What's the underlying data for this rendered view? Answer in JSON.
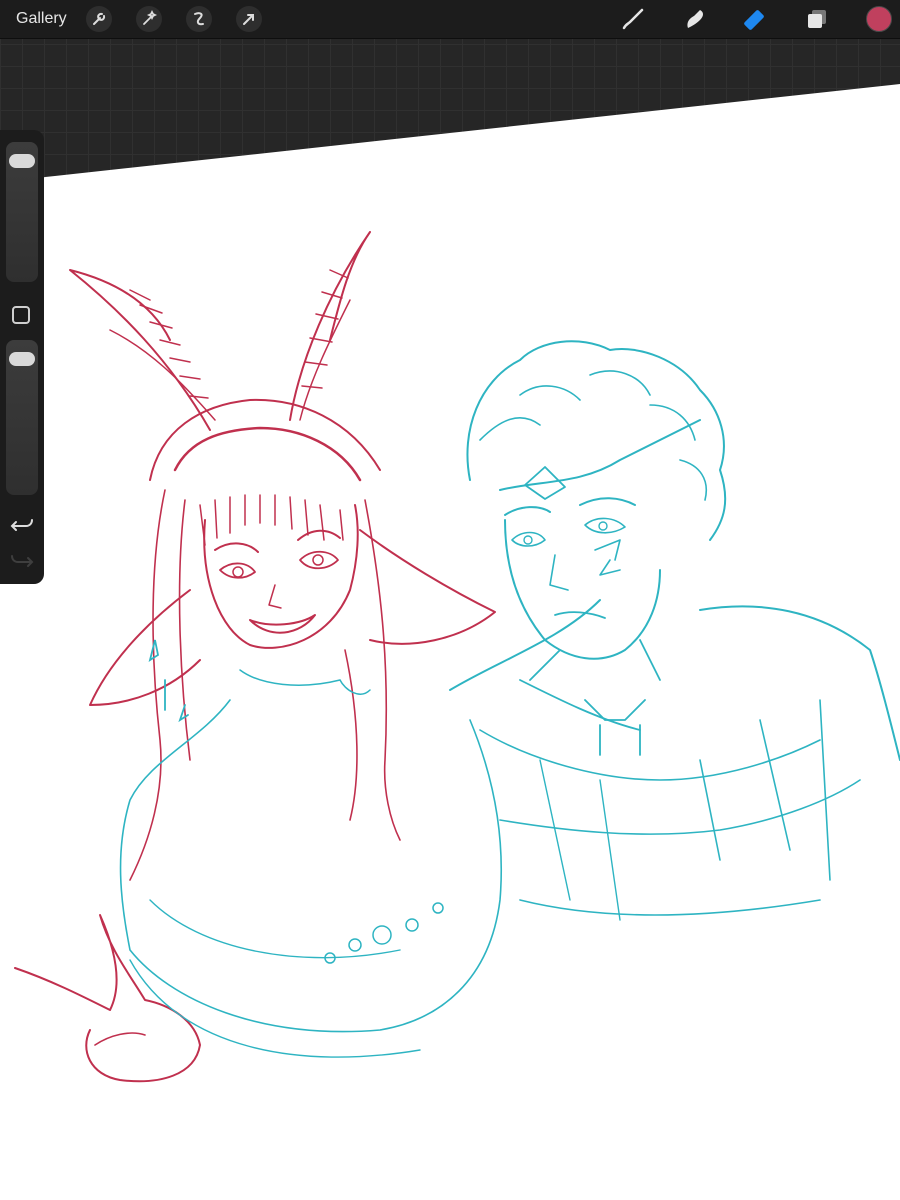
{
  "toolbar": {
    "gallery_label": "Gallery",
    "left_tools": [
      "wrench-icon",
      "magic-wand-icon",
      "selection-icon",
      "transform-arrow-icon"
    ],
    "right_tools": [
      "brush-icon",
      "smudge-icon",
      "eraser-icon",
      "layers-icon"
    ],
    "active_tool": "eraser",
    "active_color": "#c0405e"
  },
  "sidebar": {
    "brush_size": 0.95,
    "opacity": 0.95,
    "undo_enabled": true,
    "redo_enabled": false
  },
  "artwork": {
    "left_character_stroke": "#c0304e",
    "right_character_stroke": "#2eb4c2",
    "accent_teal": "#2eb4c2"
  }
}
